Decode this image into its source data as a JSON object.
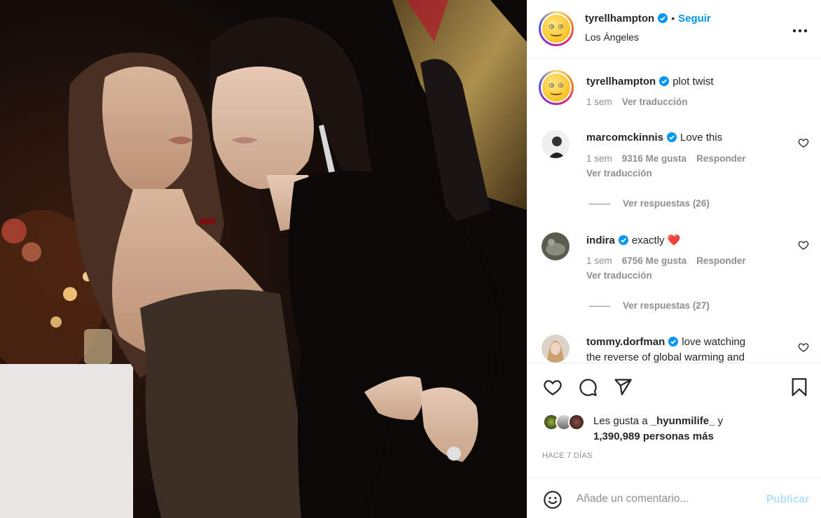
{
  "post": {
    "author": {
      "username": "tyrellhampton",
      "location": "Los Ángeles",
      "follow_label": "Seguir",
      "separator": "•",
      "more_label": "•••",
      "avatar_icon": "smiley-avatar-icon",
      "verified_icon": "verified-badge-icon"
    },
    "caption": {
      "username": "tyrellhampton",
      "text": "plot twist",
      "time": "1 sem",
      "translate": "Ver traducción"
    },
    "comments": [
      {
        "username": "marcomckinnis",
        "verified": true,
        "text": "Love this",
        "time": "1 sem",
        "likes": "9316 Me gusta",
        "reply": "Responder",
        "translate": "Ver traducción",
        "replies": "Ver respuestas (26)"
      },
      {
        "username": "indira",
        "verified": true,
        "text": "exactly",
        "emoji": "❤️",
        "time": "1 sem",
        "likes": "6756 Me gusta",
        "reply": "Responder",
        "translate": "Ver traducción",
        "replies": "Ver respuestas (27)"
      },
      {
        "username": "tommy.dorfman",
        "verified": true,
        "text": "love watching",
        "text_cont": "the reverse of global warming and"
      }
    ],
    "actions": {
      "like_icon": "heart-icon",
      "comment_icon": "comment-icon",
      "share_icon": "share-icon",
      "save_icon": "bookmark-icon"
    },
    "likes": {
      "prefix": "Les gusta a",
      "user": "_hyunmilife_",
      "conj": "y",
      "count": "1,390,989 personas más"
    },
    "time_ago": "HACE 7 DÍAS",
    "comment_box": {
      "placeholder": "Añade un comentario...",
      "publish": "Publicar",
      "emoji_icon": "emoji-icon"
    }
  },
  "colors": {
    "accent": "#0095f6",
    "publish_disabled": "#b2dffc",
    "muted": "#8e8e8e",
    "text": "#262626",
    "heart_emoji": "#ed4956"
  }
}
